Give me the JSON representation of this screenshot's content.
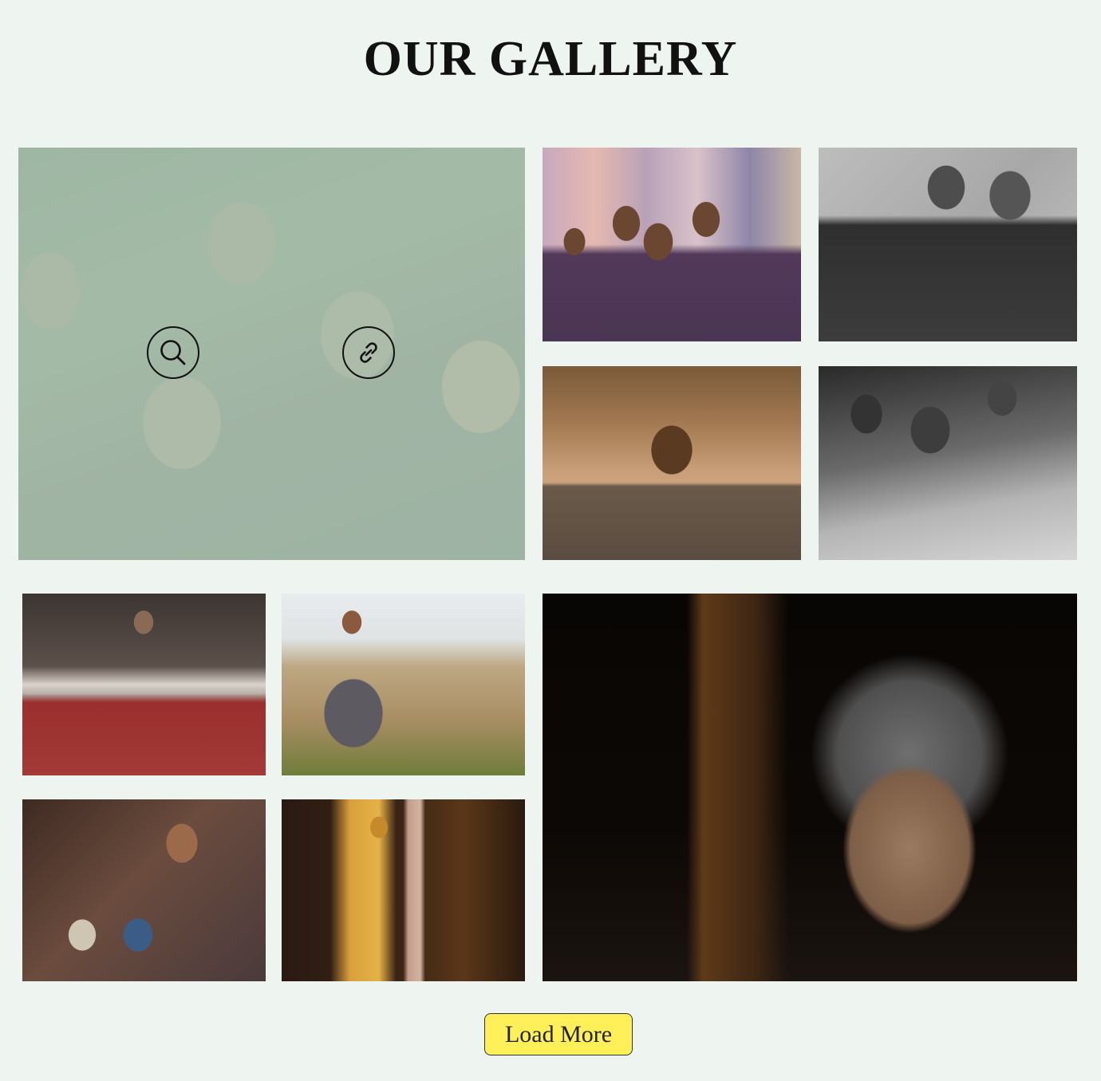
{
  "gallery": {
    "title": "OUR GALLERY",
    "load_more_label": "Load More",
    "hover_overlay_color": "#bad6c6",
    "photos": [
      {
        "subject": "group of smiling children looking up",
        "hovered": true
      },
      {
        "subject": "children posing in a street"
      },
      {
        "subject": "two boys hugging, black and white"
      },
      {
        "subject": "smiling boy outdoors"
      },
      {
        "subject": "children eating, black and white"
      },
      {
        "subject": "elderly man at sewing machine"
      },
      {
        "subject": "man crouching in a field"
      },
      {
        "subject": "woman with two young children"
      },
      {
        "subject": "woman in yellow sari by a doorway"
      },
      {
        "subject": "portrait of an elderly woman"
      }
    ],
    "hover_icons": [
      "search-icon",
      "link-icon"
    ]
  },
  "colors": {
    "page_background": "#eef5f0",
    "button_background": "#fff05a",
    "title_color": "#111111"
  }
}
